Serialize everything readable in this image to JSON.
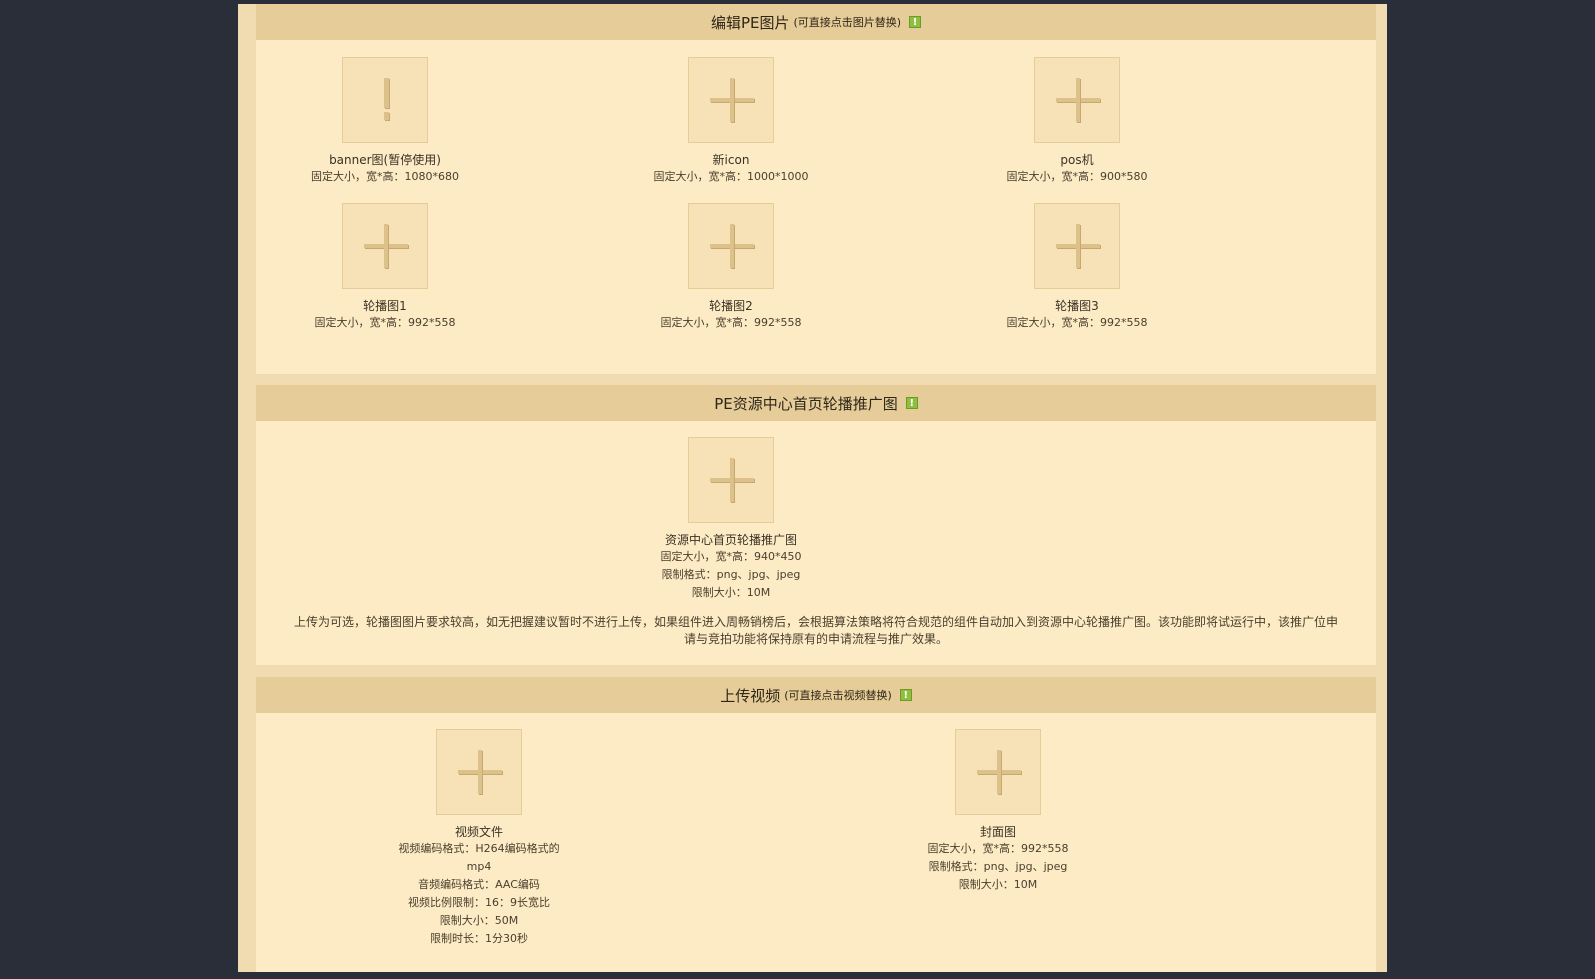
{
  "sections": [
    {
      "title": "编辑PE图片",
      "subtitle": "(可直接点击图片替换)",
      "items": [
        {
          "icon": "exclamation-icon",
          "title": "banner图(暂停使用)",
          "info": [
            "固定大小，宽*高：1080*680"
          ]
        },
        {
          "icon": "plus-icon",
          "title": "新icon",
          "info": [
            "固定大小，宽*高：1000*1000"
          ]
        },
        {
          "icon": "plus-icon",
          "title": "pos机",
          "info": [
            "固定大小，宽*高：900*580"
          ]
        },
        {
          "icon": "plus-icon",
          "title": "轮播图1",
          "info": [
            "固定大小，宽*高：992*558"
          ]
        },
        {
          "icon": "plus-icon",
          "title": "轮播图2",
          "info": [
            "固定大小，宽*高：992*558"
          ]
        },
        {
          "icon": "plus-icon",
          "title": "轮播图3",
          "info": [
            "固定大小，宽*高：992*558"
          ]
        }
      ]
    },
    {
      "title": "PE资源中心首页轮播推广图",
      "subtitle": "",
      "items": [
        {
          "icon": "plus-icon",
          "title": "资源中心首页轮播推广图",
          "info": [
            "固定大小，宽*高：940*450",
            "限制格式：png、jpg、jpeg",
            "限制大小：10M"
          ]
        }
      ],
      "notice": "上传为可选，轮播图图片要求较高，如无把握建议暂时不进行上传，如果组件进入周畅销榜后，会根据算法策略将符合规范的组件自动加入到资源中心轮播推广图。该功能即将试运行中，该推广位申请与竞拍功能将保持原有的申请流程与推广效果。"
    },
    {
      "title": "上传视频",
      "subtitle": "(可直接点击视频替换)",
      "items": [
        {
          "icon": "plus-icon",
          "title": "视频文件",
          "info": [
            "视频编码格式：H264编码格式的",
            "mp4",
            "音频编码格式：AAC编码",
            "视频比例限制：16：9长宽比",
            "限制大小：50M",
            "限制时长：1分30秒"
          ]
        },
        {
          "icon": "plus-icon",
          "title": "封面图",
          "info": [
            "固定大小，宽*高：992*558",
            "限制格式：png、jpg、jpeg",
            "限制大小：10M"
          ]
        }
      ]
    }
  ],
  "colors": {
    "background": "#2a2e38",
    "page": "#f0dcb0",
    "panel": "#fcebc4",
    "header": "#e6cc98",
    "warn": "#8fbf3f"
  }
}
